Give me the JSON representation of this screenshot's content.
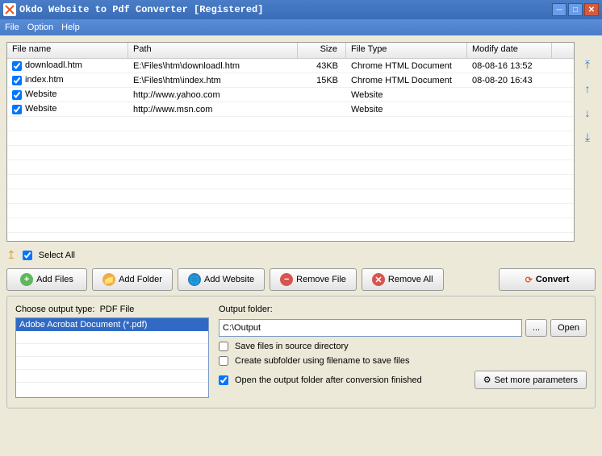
{
  "window": {
    "title": "Okdo Website to Pdf Converter [Registered]"
  },
  "menu": {
    "file": "File",
    "option": "Option",
    "help": "Help"
  },
  "columns": {
    "name": "File name",
    "path": "Path",
    "size": "Size",
    "type": "File Type",
    "date": "Modify date"
  },
  "rows": [
    {
      "checked": true,
      "name": "downloadl.htm",
      "path": "E:\\Files\\htm\\downloadl.htm",
      "size": "43KB",
      "type": "Chrome HTML Document",
      "date": "08-08-16 13:52"
    },
    {
      "checked": true,
      "name": "index.htm",
      "path": "E:\\Files\\htm\\index.htm",
      "size": "15KB",
      "type": "Chrome HTML Document",
      "date": "08-08-20 16:43"
    },
    {
      "checked": true,
      "name": "Website",
      "path": "http://www.yahoo.com",
      "size": "",
      "type": "Website",
      "date": ""
    },
    {
      "checked": true,
      "name": "Website",
      "path": "http://www.msn.com",
      "size": "",
      "type": "Website",
      "date": ""
    }
  ],
  "selectAll": {
    "label": "Select All",
    "checked": true
  },
  "buttons": {
    "addFiles": "Add Files",
    "addFolder": "Add Folder",
    "addWebsite": "Add Website",
    "removeFile": "Remove File",
    "removeAll": "Remove All",
    "convert": "Convert"
  },
  "outputType": {
    "label": "Choose output type:",
    "current": "PDF File",
    "item": "Adobe Acrobat Document (*.pdf)"
  },
  "outputFolder": {
    "label": "Output folder:",
    "value": "C:\\Output",
    "browse": "...",
    "open": "Open"
  },
  "options": {
    "saveSource": {
      "label": "Save files in source directory",
      "checked": false
    },
    "subfolder": {
      "label": "Create subfolder using filename to save files",
      "checked": false
    },
    "openAfter": {
      "label": "Open the output folder after conversion finished",
      "checked": true
    }
  },
  "paramsBtn": "Set more parameters"
}
